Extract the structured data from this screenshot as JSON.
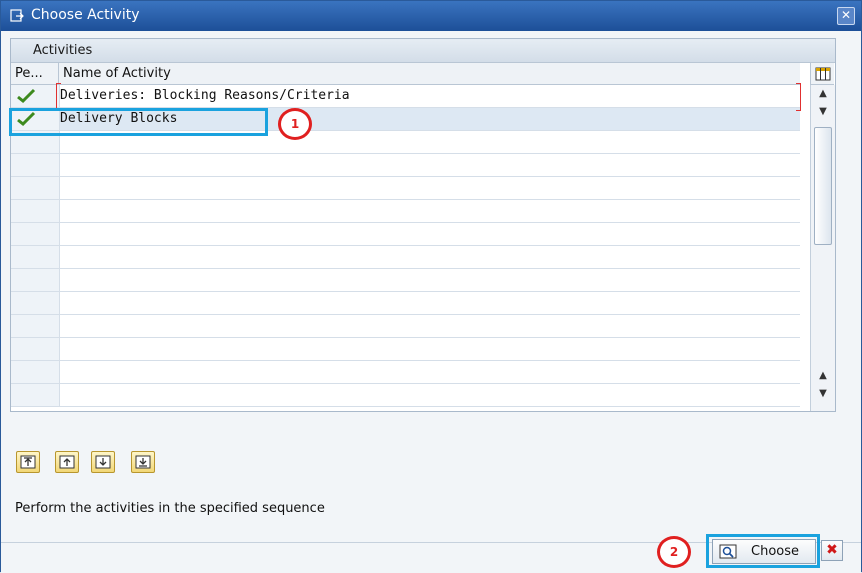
{
  "window": {
    "title": "Choose Activity",
    "close_glyph": "✕"
  },
  "panel": {
    "title": "Activities",
    "columns": [
      "Pe...",
      "Name of Activity"
    ]
  },
  "rows": [
    {
      "performed": true,
      "name": "Deliveries: Blocking Reasons/Criteria"
    },
    {
      "performed": true,
      "name": "Delivery Blocks",
      "selected": true
    }
  ],
  "annotations": {
    "marker_1": "1",
    "marker_2": "2"
  },
  "hint_text": "Perform the activities in the specified sequence",
  "buttons": {
    "choose_label": "Choose",
    "cancel_glyph": "✖"
  },
  "icons": {
    "check": "green-check-icon",
    "toolbar": [
      "move-first-icon",
      "move-up-icon",
      "move-down-icon",
      "move-last-icon"
    ]
  },
  "colors": {
    "title_bar": "#1d4f98",
    "highlight_box": "#1aa2de",
    "annotation_circle": "#e02020",
    "check_mark": "#3d8a1e"
  }
}
